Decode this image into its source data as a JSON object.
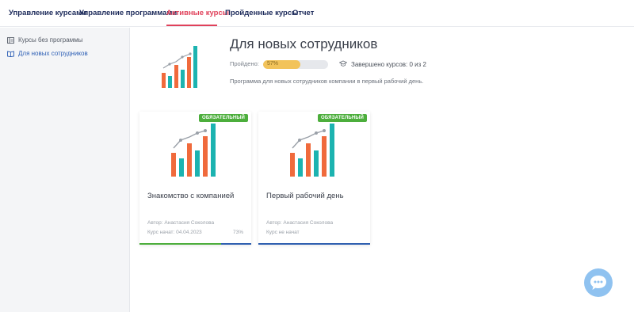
{
  "nav": {
    "tabs": [
      {
        "label": "Управление курсами"
      },
      {
        "label": "Управление программами"
      },
      {
        "label": "Активные курсы"
      },
      {
        "label": "Пройденные курсы"
      },
      {
        "label": "Отчет"
      }
    ],
    "active_index": 2
  },
  "sidebar": {
    "items": [
      {
        "label": "Курсы без программы",
        "icon": "catalog-icon"
      },
      {
        "label": "Для новых сотрудников",
        "icon": "book-icon"
      }
    ]
  },
  "program": {
    "title": "Для новых сотрудников",
    "passed_label": "Пройдено:",
    "progress_percent": 57,
    "progress_text": "57%",
    "completed_text": "Завершено курсов: 0 из 2",
    "description": "Программа для новых сотрудников компании в первый рабочий день."
  },
  "cards": [
    {
      "badge": "ОБЯЗАТЕЛЬНЫЙ",
      "title": "Знакомство с компанией",
      "author": "Автор: Анастасия Соколова",
      "status": "Курс начат: 04.04.2023",
      "percent": "73%",
      "progress": 0.73
    },
    {
      "badge": "ОБЯЗАТЕЛЬНЫЙ",
      "title": "Первый рабочий день",
      "author": "Автор: Анастасия Соколова",
      "status": "Курс не начат",
      "percent": "",
      "progress": 0
    }
  ],
  "colors": {
    "accent": "#e0415a",
    "nav_text": "#1c2a5a",
    "link": "#2d5fb5",
    "badge": "#4cae3c",
    "progress": "#f2c35a",
    "bar_orange": "#f06a3c",
    "bar_teal": "#1cb3b0",
    "chat": "#8fc2f0"
  }
}
